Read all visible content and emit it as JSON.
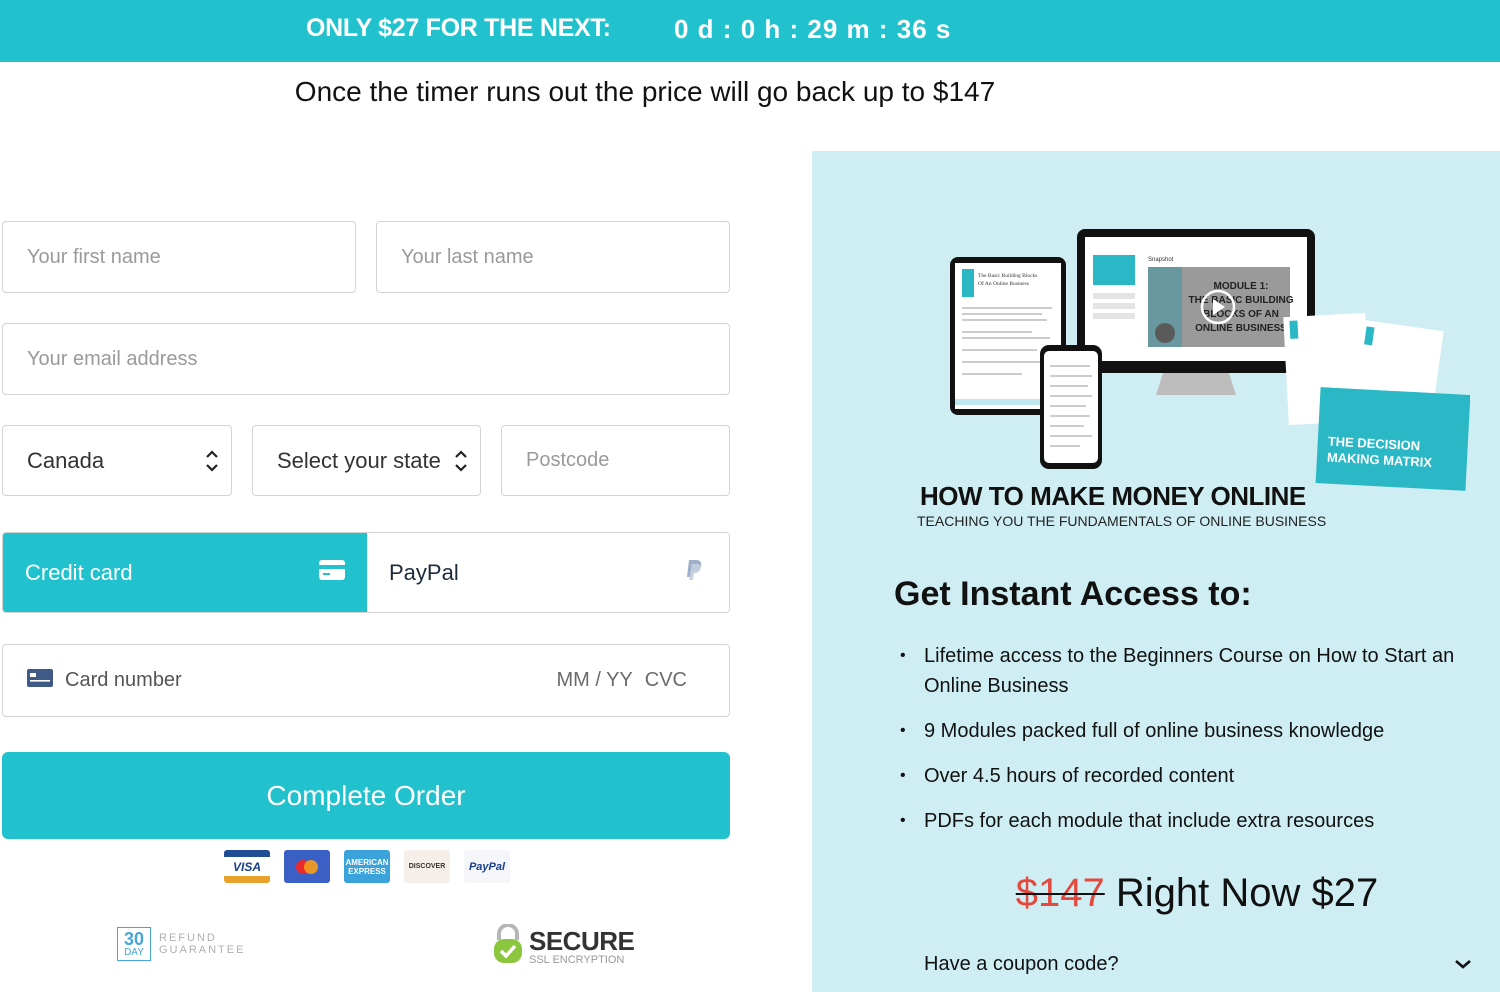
{
  "banner": {
    "lead": "ONLY $27 FOR THE NEXT:",
    "timer": {
      "days": "0 d",
      "hours": "0 h",
      "minutes": "29 m",
      "seconds": "36 s",
      "separator": " : "
    }
  },
  "subline": "Once the timer runs out the price will go back up to $147",
  "form": {
    "first_name": {
      "placeholder": "Your first name",
      "value": ""
    },
    "last_name": {
      "placeholder": "Your last name",
      "value": ""
    },
    "email": {
      "placeholder": "Your email address",
      "value": ""
    },
    "country": {
      "value": "Canada"
    },
    "state": {
      "value": "Select your state"
    },
    "postcode": {
      "placeholder": "Postcode",
      "value": ""
    }
  },
  "payment": {
    "tabs": [
      {
        "label": "Credit card",
        "icon": "credit-card-icon",
        "active": true
      },
      {
        "label": "PayPal",
        "icon": "paypal-icon",
        "active": false
      }
    ],
    "card_number_placeholder": "Card number",
    "expiry_placeholder": "MM / YY",
    "cvc_placeholder": "CVC"
  },
  "complete_button": "Complete Order",
  "card_logos": [
    {
      "name": "visa",
      "label": "VISA"
    },
    {
      "name": "mastercard",
      "label": ""
    },
    {
      "name": "amex",
      "label": "AMERICAN EXPRESS"
    },
    {
      "name": "discover",
      "label": "DISCOVER"
    },
    {
      "name": "paypal",
      "label": "PayPal"
    }
  ],
  "badges": {
    "refund": {
      "number": "30",
      "unit": "DAY",
      "line1": "REFUND",
      "line2": "GUARANTEE"
    },
    "secure": {
      "title": "SECURE",
      "subtitle": "SSL ENCRYPTION"
    }
  },
  "product": {
    "title": "HOW TO MAKE MONEY ONLINE",
    "subtitle": "TEACHING YOU THE FUNDAMENTALS OF ONLINE BUSINESS",
    "monitor_text": "MODULE 1: THE BASIC BUILDING BLOCKS OF AN ONLINE BUSINESS",
    "monitor_tab": "Snapshot",
    "tablet_text": "The Basic Building Blocks Of An Online Business",
    "card_text": "THE DECISION MAKING MATRIX"
  },
  "access": {
    "title": "Get Instant Access to:",
    "items": [
      "Lifetime access to the Beginners Course on How to Start an Online Business",
      "9 Modules packed full of online business knowledge",
      "Over 4.5 hours of recorded content",
      "PDFs for each module that include extra resources"
    ]
  },
  "pricing": {
    "old": "$147",
    "now_label": "Right Now $27"
  },
  "coupon": {
    "label": "Have a coupon code?"
  },
  "colors": {
    "accent": "#21c2cd",
    "panel": "#cfeef3",
    "strike": "#e5483d"
  }
}
